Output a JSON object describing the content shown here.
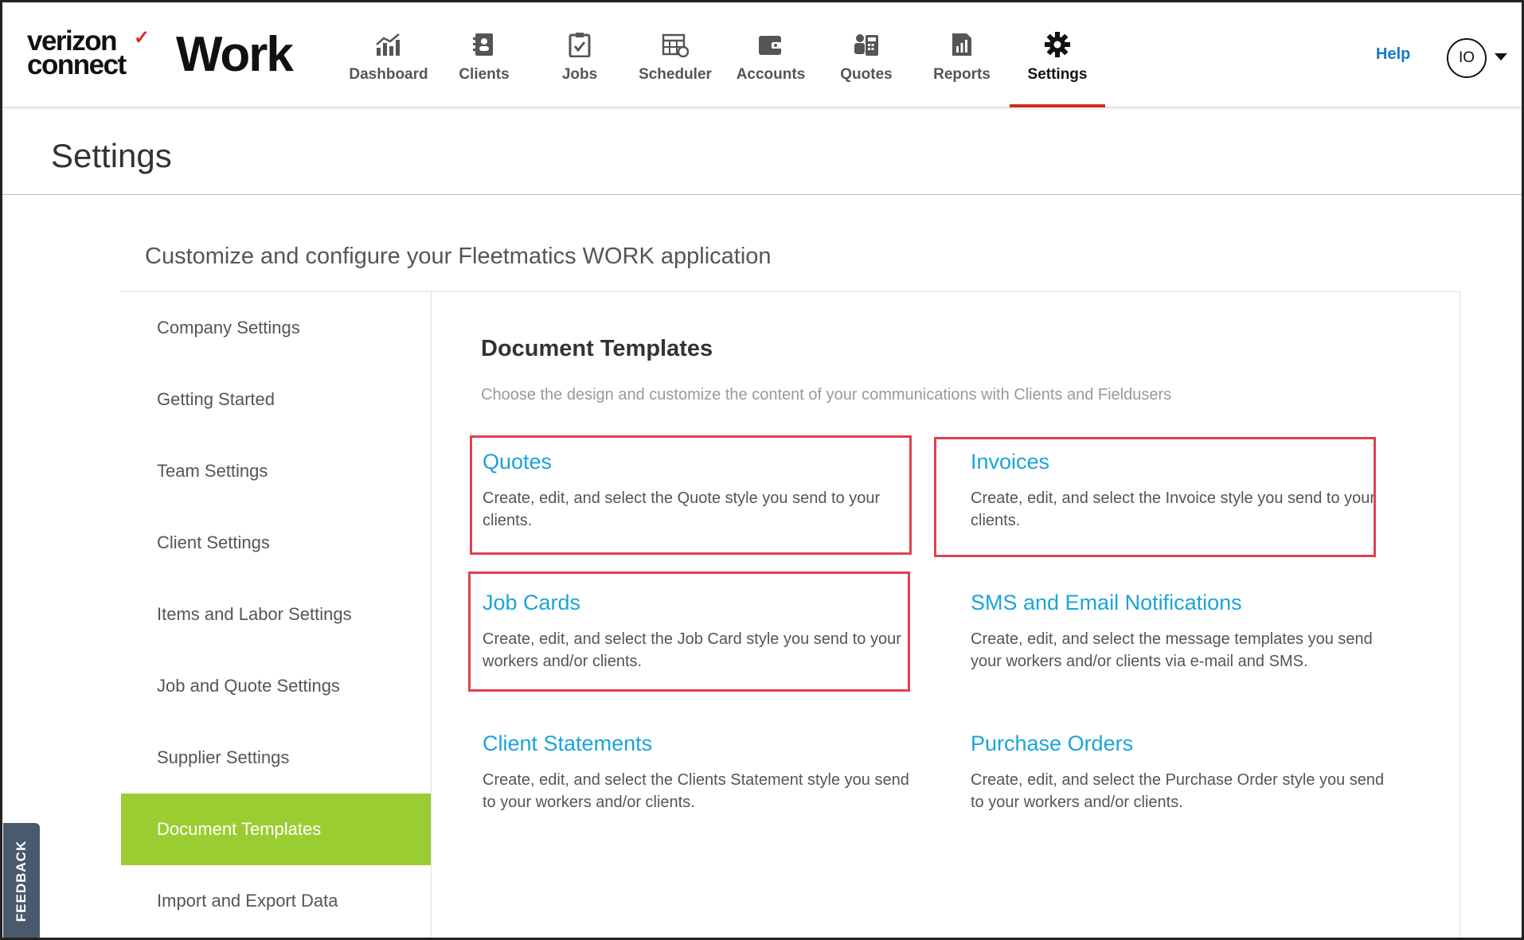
{
  "brand": {
    "vendor_line1": "verizon",
    "vendor_line2": "connect",
    "product": "Work"
  },
  "nav": {
    "items": [
      {
        "label": "Dashboard",
        "icon": "dashboard-chart-icon"
      },
      {
        "label": "Clients",
        "icon": "clients-contact-icon"
      },
      {
        "label": "Jobs",
        "icon": "jobs-clipboard-icon"
      },
      {
        "label": "Scheduler",
        "icon": "scheduler-calendar-icon"
      },
      {
        "label": "Accounts",
        "icon": "accounts-wallet-icon"
      },
      {
        "label": "Quotes",
        "icon": "quotes-calculator-icon"
      },
      {
        "label": "Reports",
        "icon": "reports-chart-icon"
      },
      {
        "label": "Settings",
        "icon": "settings-gear-icon"
      }
    ],
    "active": "Settings",
    "help": "Help",
    "user_initials": "IO"
  },
  "page": {
    "title": "Settings",
    "subtitle": "Customize and configure your Fleetmatics WORK application"
  },
  "sidebar": {
    "items": [
      {
        "label": "Company Settings"
      },
      {
        "label": "Getting Started"
      },
      {
        "label": "Team Settings"
      },
      {
        "label": "Client Settings"
      },
      {
        "label": "Items and Labor Settings"
      },
      {
        "label": "Job and Quote Settings"
      },
      {
        "label": "Supplier Settings"
      },
      {
        "label": "Document Templates"
      },
      {
        "label": "Import and Export Data"
      }
    ],
    "active": "Document Templates"
  },
  "main": {
    "title": "Document Templates",
    "description": "Choose the design and customize the content of your communications with Clients and Fieldusers",
    "cards": [
      {
        "title": "Quotes",
        "text": "Create, edit, and select the Quote style you send to your clients.",
        "highlighted": true
      },
      {
        "title": "Invoices",
        "text": "Create, edit, and select the Invoice style you send to your clients.",
        "highlighted": true
      },
      {
        "title": "Job Cards",
        "text": "Create, edit, and select the Job Card style you send to your workers and/or clients.",
        "highlighted": true
      },
      {
        "title": "SMS and Email Notifications",
        "text": "Create, edit, and select the message templates you send your workers and/or clients via e-mail and SMS.",
        "highlighted": false
      },
      {
        "title": "Client Statements",
        "text": "Create, edit, and select the Clients Statement style you send to your workers and/or clients.",
        "highlighted": false
      },
      {
        "title": "Purchase Orders",
        "text": "Create, edit, and select the Purchase Order style you send to your workers and/or clients.",
        "highlighted": false
      }
    ]
  },
  "feedback": {
    "label": "FEEDBACK"
  },
  "colors": {
    "accent_green": "#9acd32",
    "link_blue": "#1ba4d8",
    "active_underline": "#d52b1e",
    "highlight_box": "#e04050",
    "help_blue": "#1479c8"
  }
}
